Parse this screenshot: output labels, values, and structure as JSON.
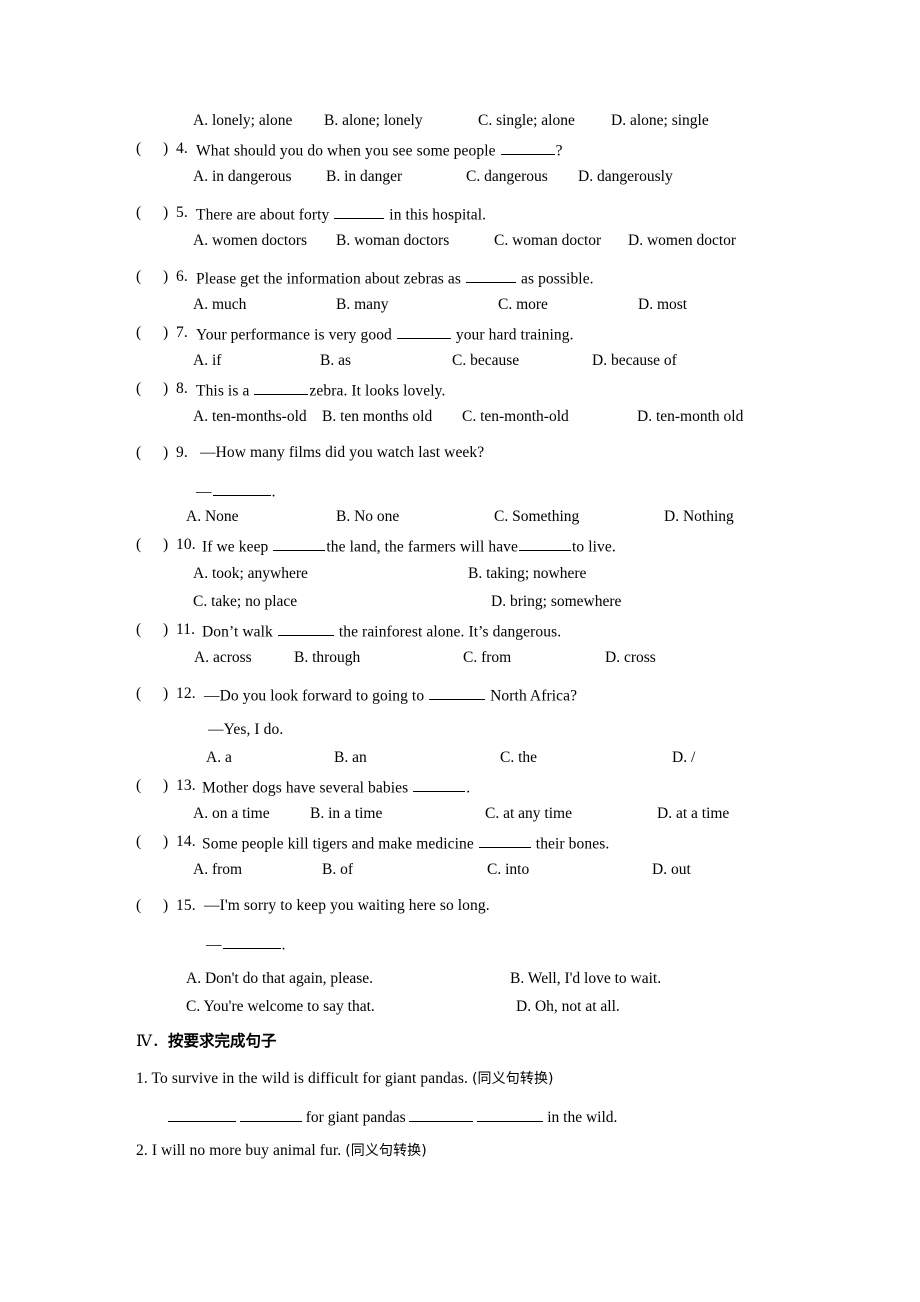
{
  "document": {
    "type": "english-exam-worksheet-page",
    "language_mix": "English with Chinese instructions"
  },
  "multiple_choice": {
    "orphan_options_row": {
      "note": "options row belonging to question 3, whose stem is cut off above the top of the page",
      "options": [
        "A. lonely; alone",
        "B. alone; lonely",
        "C. single; alone",
        "D. alone; single"
      ]
    },
    "bracket_open": "(",
    "bracket_close": ")",
    "questions": [
      {
        "number": "4.",
        "stem_before": "What should you do when you see some people ",
        "stem_after": "?",
        "has_blank": true,
        "options": [
          "A. in dangerous",
          "B. in danger",
          "C. dangerous",
          "D. dangerously"
        ],
        "layout": "four-across"
      },
      {
        "number": "5.",
        "stem_before": "There are about forty ",
        "stem_after": " in this hospital.",
        "has_blank": true,
        "options": [
          "A. women doctors",
          "B. woman doctors",
          "C. woman doctor",
          "D. women doctor"
        ],
        "layout": "four-across"
      },
      {
        "number": "6.",
        "stem_before": "Please get the information about zebras as ",
        "stem_after": " as possible.",
        "has_blank": true,
        "options": [
          "A. much",
          "B. many",
          "C. more",
          "D. most"
        ],
        "layout": "four-across"
      },
      {
        "number": "7.",
        "stem_before": "Your performance is very good ",
        "stem_after": " your hard training.",
        "has_blank": true,
        "options": [
          "A. if",
          "B. as",
          "C. because",
          "D. because of"
        ],
        "layout": "four-across"
      },
      {
        "number": "8.",
        "stem_before": "This is a ",
        "stem_after": "zebra. It looks lovely.",
        "has_blank": true,
        "options": [
          "A. ten-months-old",
          "B. ten months old",
          "C. ten-month-old",
          "D. ten-month old"
        ],
        "layout": "four-across"
      },
      {
        "number": "9.",
        "stem_before": "—How many films did you watch last week?",
        "stem_after": "",
        "has_blank": false,
        "reply_line": "—",
        "reply_tail": ".",
        "options": [
          "A. None",
          "B. No one",
          "C. Something",
          "D. Nothing"
        ],
        "layout": "four-across"
      },
      {
        "number": "10.",
        "stem_before": "If we keep ",
        "stem_mid": "the land, the farmers will have",
        "stem_after": "to live.",
        "has_blank": true,
        "options": [
          "A. took; anywhere",
          "B. taking; nowhere",
          "C. take; no place",
          "D. bring; somewhere"
        ],
        "layout": "two-by-two"
      },
      {
        "number": "11.",
        "stem_before": "Don’t walk ",
        "stem_after": " the rainforest alone. It’s dangerous.",
        "has_blank": true,
        "options": [
          "A. across",
          "B. through",
          "C. from",
          "D. cross"
        ],
        "layout": "four-across"
      },
      {
        "number": "12.",
        "stem_before": "—Do you look forward to going to ",
        "stem_after": " North Africa?",
        "has_blank": true,
        "reply_line": "—Yes, I do.",
        "options": [
          "A. a",
          "B. an",
          "C. the",
          "D. /"
        ],
        "layout": "four-across"
      },
      {
        "number": "13.",
        "stem_before": "Mother dogs have several babies ",
        "stem_after": ".",
        "has_blank": true,
        "options": [
          "A. on a time",
          "B. in a time",
          "C. at any time",
          "D. at a time"
        ],
        "layout": "four-across"
      },
      {
        "number": "14.",
        "stem_before": "Some people kill tigers and make medicine ",
        "stem_after": " their bones.",
        "has_blank": true,
        "options": [
          "A. from",
          "B. of",
          "C. into",
          "D. out"
        ],
        "layout": "four-across"
      },
      {
        "number": "15.",
        "stem_before": "—I'm sorry to keep you waiting here so long.",
        "stem_after": "",
        "has_blank": false,
        "reply_line": "—",
        "reply_tail": ".",
        "options": [
          "A. Don't do that again, please.",
          "B. Well, I'd love to wait.",
          "C. You're welcome to say that.",
          "D. Oh, not at all."
        ],
        "layout": "two-by-two"
      }
    ]
  },
  "section_four": {
    "roman": "Ⅳ．",
    "title_cn": "按要求完成句子",
    "items": [
      {
        "number": "1.",
        "sentence": "To survive in the wild is difficult for giant pandas.",
        "instruction": "(同义句转换)",
        "answer_line": {
          "segments": [
            "for giant pandas",
            "in the wild."
          ],
          "blank_count": 4
        }
      },
      {
        "number": "2.",
        "sentence": "I will no more buy animal fur.",
        "instruction": "(同义句转换)"
      }
    ]
  }
}
